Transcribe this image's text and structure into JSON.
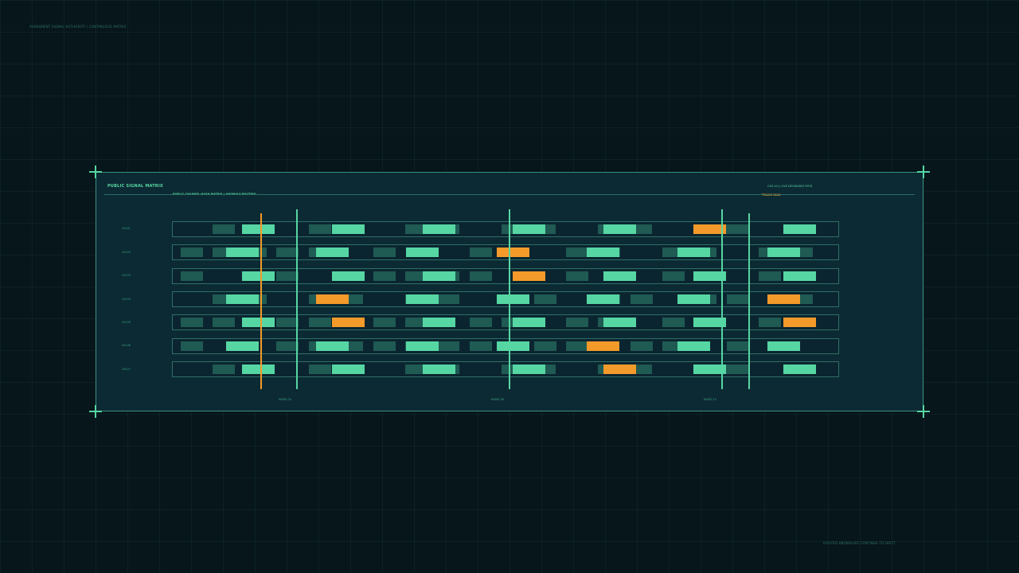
{
  "header": {
    "authority": "AVANSMENT SIGNAL AUTHORITY / CONTINUOUS MATRIX"
  },
  "panel": {
    "title": "PUBLIC SIGNAL MATRIX",
    "subtitle": "PUBLIC CHANNEL HASH MATRIX / ANOMALY ROUTING",
    "status": "CHS 44 // LIVE DEGRADED FEED",
    "track_label": "TRACK BIAS"
  },
  "rows": [
    {
      "label": "CH-01"
    },
    {
      "label": "CH-02"
    },
    {
      "label": "CH-03"
    },
    {
      "label": "CH-04"
    },
    {
      "label": "CH-05"
    },
    {
      "label": "CH-06"
    },
    {
      "label": "CH-07"
    }
  ],
  "axis": {
    "labels": [
      "NODE 04",
      "NODE 08",
      "NODE 12"
    ]
  },
  "footer": {
    "note": "ROUTED ANOMALIES CONTINUE TO DRIFT"
  },
  "colors": {
    "background": "#07161b",
    "panel": "#0c2a33",
    "signal": "#56d6a3",
    "signal_dim": "#1f5a53",
    "anomaly": "#f39a2a",
    "frame": "#3a8f7c"
  }
}
